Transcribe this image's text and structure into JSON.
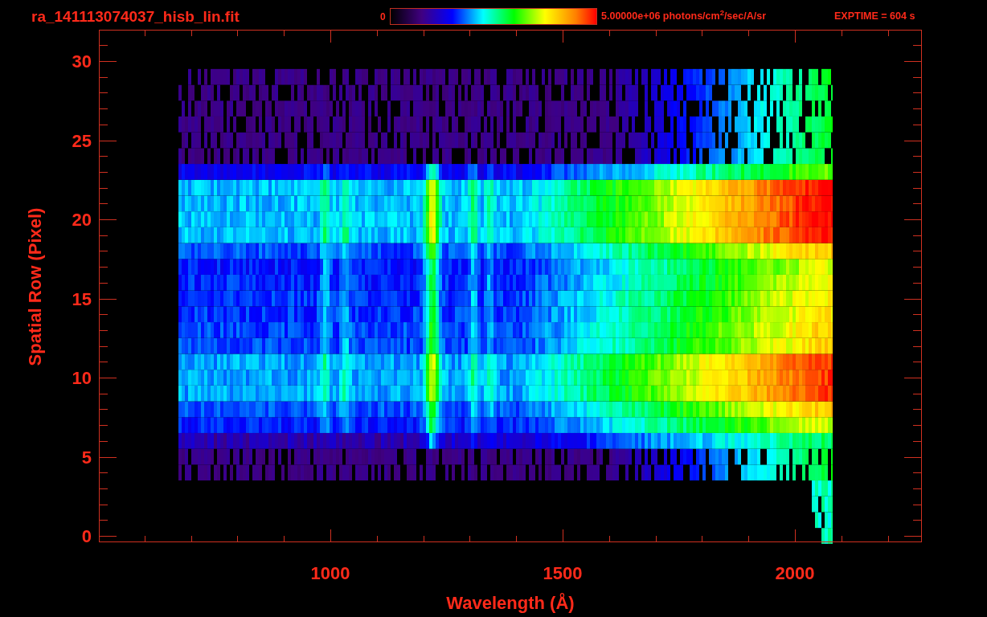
{
  "title": "ra_141113074037_hisb_lin.fit",
  "colorbar": {
    "min_label": "0",
    "max_label": "5.00000e+06 photons/cm$^{2}$/sec/A/sr"
  },
  "exptime": "EXPTIME = 604 s",
  "plot": {
    "xlabel": "Wavelength (Å)",
    "ylabel": "Spatial Row (Pixel)",
    "x_tick_labels": [
      "1000",
      "1500",
      "2000"
    ],
    "y_tick_labels": [
      "30",
      "25",
      "20",
      "15",
      "10",
      "5",
      "0"
    ]
  }
}
